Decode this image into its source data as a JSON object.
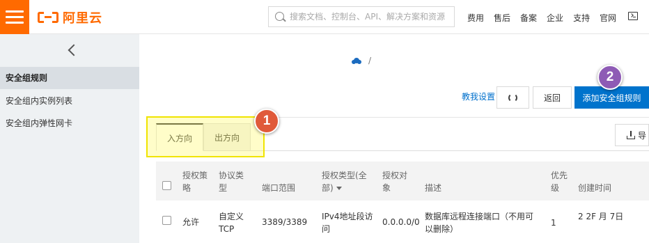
{
  "header": {
    "logo_text": "阿里云",
    "search_placeholder": "搜索文档、控制台、API、解决方案和资源",
    "nav": [
      "费用",
      "售后",
      "备案",
      "企业",
      "支持",
      "官网"
    ]
  },
  "sidebar": {
    "items": [
      {
        "label": "安全组规则",
        "active": true
      },
      {
        "label": "安全组内实例列表",
        "active": false
      },
      {
        "label": "安全组内弹性网卡",
        "active": false
      }
    ]
  },
  "breadcrumb": {
    "separator": "/"
  },
  "toolbar": {
    "teach_link": "教我设置",
    "back_label": "返回",
    "add_rule_label": "添加安全组规则"
  },
  "tabs": [
    {
      "label": "入方向",
      "active": true
    },
    {
      "label": "出方向",
      "active": false
    }
  ],
  "annotations": {
    "callout_1": "1",
    "callout_2": "2"
  },
  "export_label": "导",
  "table": {
    "headers": {
      "policy": [
        "授权策",
        "略"
      ],
      "protocol": [
        "协议类",
        "型"
      ],
      "port_range": "端口范围",
      "auth_type": [
        "授权类型(全",
        "部)"
      ],
      "auth_object": [
        "授权对",
        "象"
      ],
      "description": "描述",
      "priority": [
        "优先",
        "级"
      ],
      "created": "创建时间"
    },
    "rows": [
      {
        "policy": "允许",
        "protocol": [
          "自定义",
          "TCP"
        ],
        "port_range": "3389/3389",
        "auth_type": [
          "IPv4地址段访",
          "问"
        ],
        "auth_object": "0.0.0.0/0",
        "description": [
          "数据库远程连接端口（不用可",
          "以删除）"
        ],
        "priority": "1",
        "created": "2  2F  月  7日"
      }
    ]
  },
  "colors": {
    "brand": "#ff6a00",
    "primary": "#0073cc",
    "link": "#0070cc",
    "callout_1": "#e05a3a",
    "callout_2": "#8e5bb5",
    "highlight": "#f0e400"
  }
}
